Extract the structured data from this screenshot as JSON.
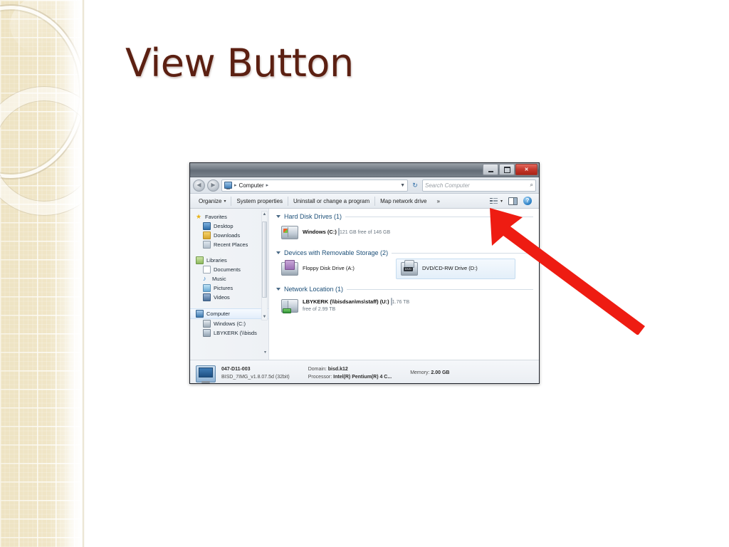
{
  "slide": {
    "title": "View Button",
    "title_color": "#5c2012",
    "background_color": "#ffffff",
    "sidebar_color": "#efe4c4"
  },
  "annotation": {
    "arrow_name": "red-arrow",
    "arrow_color": "#ee1c12",
    "points_to": "view-button"
  },
  "explorer": {
    "titlebar": {
      "minimize_label": "",
      "maximize_label": "",
      "close_label": "✕"
    },
    "addressbar": {
      "back_label": "◀",
      "forward_label": "▶",
      "breadcrumb_root": "Computer",
      "breadcrumb_chevron": "▸",
      "breadcrumb_dropdown": "▼",
      "refresh_label": "↻",
      "search_placeholder": "Search Computer",
      "search_value": "",
      "search_icon": "⌕"
    },
    "toolbar": {
      "organize": "Organize",
      "organize_caret": "▾",
      "system_properties": "System properties",
      "uninstall": "Uninstall or change a program",
      "map_network_drive": "Map network drive",
      "overflow": "»",
      "view_caret": "▾",
      "help_label": "?"
    },
    "nav_pane": {
      "groups": [
        {
          "name": "Favorites",
          "items": [
            "Desktop",
            "Downloads",
            "Recent Places"
          ]
        },
        {
          "name": "Libraries",
          "items": [
            "Documents",
            "Music",
            "Pictures",
            "Videos"
          ]
        },
        {
          "name": "Computer",
          "items": [
            "Windows (C:)",
            "LBYKERK (\\\\bisds"
          ]
        }
      ],
      "scroll_up": "▲",
      "scroll_down": "▼",
      "more_arrow": "▾"
    },
    "content": {
      "groups": [
        {
          "title": "Hard Disk Drives (1)",
          "items": [
            {
              "name": "Windows (C:)",
              "capacity_label": "121 GB free of 146 GB",
              "used_percent": 17,
              "icon": "hard-drive-icon",
              "selected": false,
              "has_meter": true
            }
          ]
        },
        {
          "title": "Devices with Removable Storage (2)",
          "items": [
            {
              "name": "Floppy Disk Drive (A:)",
              "capacity_label": "",
              "used_percent": 0,
              "icon": "floppy-drive-icon",
              "selected": false,
              "has_meter": false
            },
            {
              "name": "DVD/CD-RW Drive (D:)",
              "capacity_label": "",
              "used_percent": 0,
              "icon": "dvd-drive-icon",
              "selected": true,
              "has_meter": false
            }
          ]
        },
        {
          "title": "Network Location (1)",
          "items": [
            {
              "name": "LBYKERK (\\\\bisdsan\\ms\\staff) (U:)",
              "capacity_label": "1.76 TB free of 2.99 TB",
              "used_percent": 41,
              "icon": "network-drive-icon",
              "selected": false,
              "has_meter": true
            }
          ]
        }
      ]
    },
    "statusbar": {
      "computer_name": "047-D11-003",
      "image_name": "BISD_7IMG_v1.8.07.5d  (32bit)",
      "domain_key": "Domain:",
      "domain_value": "bisd.k12",
      "processor_key": "Processor:",
      "processor_value": "Intel(R) Pentium(R) 4 C...",
      "memory_key": "Memory:",
      "memory_value": "2.00 GB"
    }
  }
}
